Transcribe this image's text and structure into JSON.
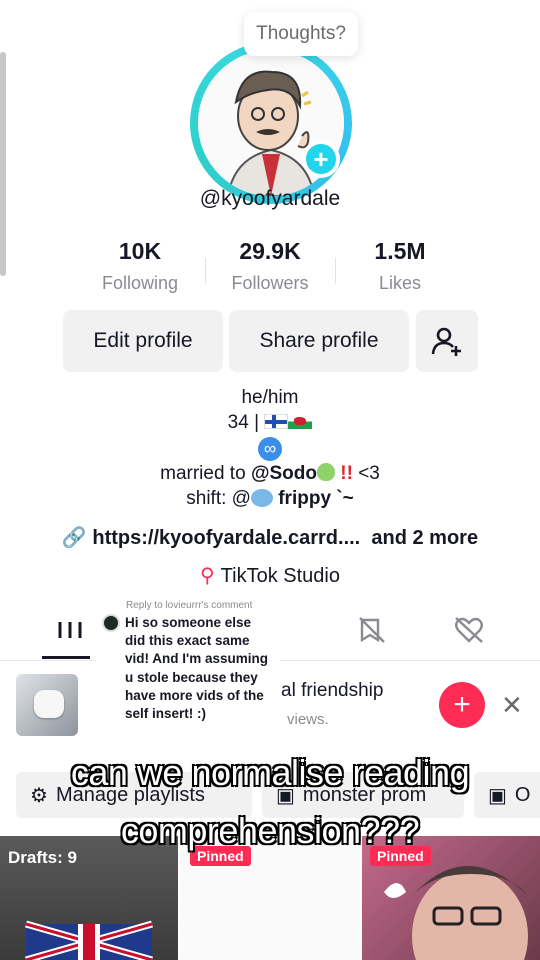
{
  "profile": {
    "thoughts_bubble": "Thoughts?",
    "username": "@kyoofyardale",
    "stats": [
      {
        "value": "10K",
        "label": "Following"
      },
      {
        "value": "29.9K",
        "label": "Followers"
      },
      {
        "value": "1.5M",
        "label": "Likes"
      }
    ],
    "buttons": {
      "edit": "Edit profile",
      "share": "Share profile",
      "add_friend_icon": "add-friend-icon"
    },
    "bio": {
      "pronouns": "he/him",
      "age": "34 |",
      "married_prefix": "married to",
      "married_name": "@Sodo",
      "married_suffix": "<3",
      "shift_prefix": "shift: @",
      "shift_name": "frippy",
      "shift_suffix": "`~"
    },
    "link": "https://kyoofyardale.carrd....",
    "link_more": "and 2 more",
    "studio": "TikTok Studio"
  },
  "comment": {
    "reply_header": "Reply to lovieurrr's comment",
    "text": "Hi so someone else did this exact same vid! And I'm assuming u stole because they have more vids of the self insert! :)"
  },
  "suggestion": {
    "title": "al friendship",
    "subtitle": "views."
  },
  "playlists": [
    "Manage playlists",
    "monster prom",
    "O"
  ],
  "grid": {
    "drafts": "Drafts: 9",
    "pinned": "Pinned"
  },
  "caption": {
    "line1": "can we normalise reading",
    "line2": "comprehension???"
  },
  "colors": {
    "accent": "#fe2c55",
    "ring": "#20d5ec"
  }
}
